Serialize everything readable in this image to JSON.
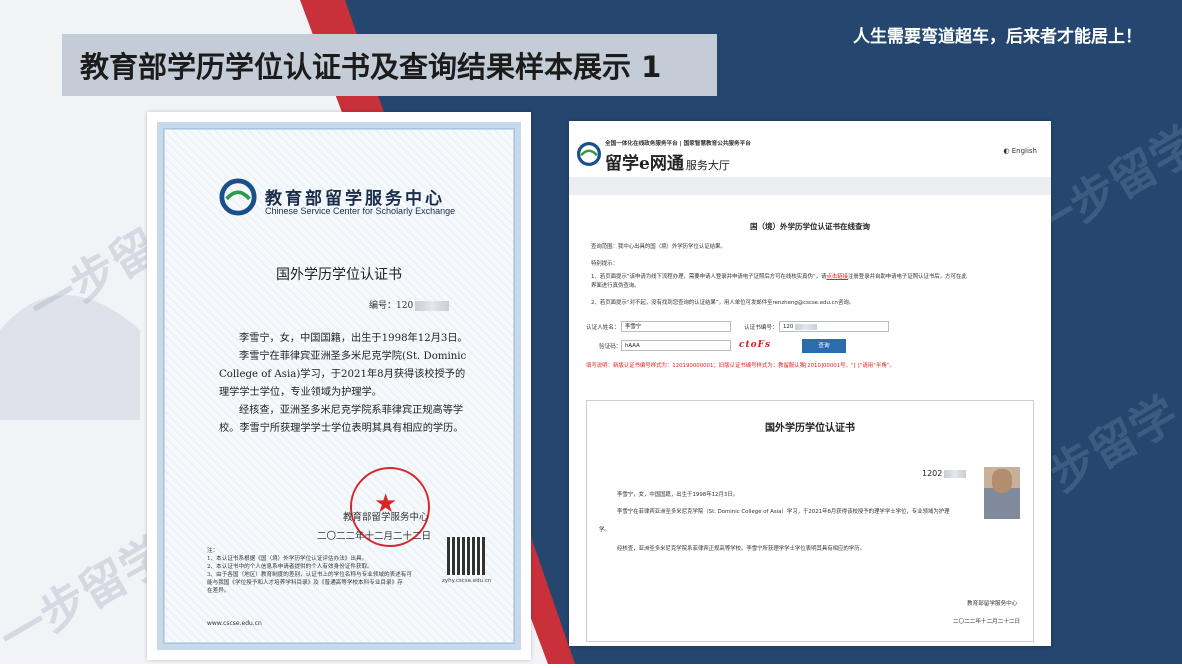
{
  "slide": {
    "title": "教育部学历学位认证书及查询结果样本展示 1",
    "slogan": "人生需要弯道超车，后来者才能居上！",
    "watermark": "一步留学"
  },
  "certificate": {
    "org_cn": "教育部留学服务中心",
    "org_en": "Chinese Service Center for Scholarly Exchange",
    "title": "国外学历学位认证书",
    "number": "编号：120",
    "paragraphs": [
      "李雪宁，女，中国国籍，出生于1998年12月3日。",
      "李雪宁在菲律宾亚洲圣多米尼克学院(St. Dominic College of Asia)学习，于2021年8月获得该校授予的理学学士学位，专业领域为护理学。",
      "经核查，亚洲圣多米尼克学院系菲律宾正规高等学校。李雪宁所获理学学士学位表明其具有相应的学历。"
    ],
    "sign": "教育部留学服务中心",
    "date": "二〇二二年十二月二十二日",
    "qr_caption": "zyhy.cscse.edu.cn",
    "notes": [
      "注：",
      "1、本认证书系根据《国（境）外学历学位认证评估办法》出具。",
      "2、本认证书中的个人信息系申请者提供的个人有效身份证件获取。",
      "3、由于各国（地区）教育制度的差别，认证书上的学位名称与专业领域的表述有可",
      "能与我国《学位授予和人才培养学科目录》及《普通高等学校本科专业目录》存",
      "在差异。"
    ],
    "url": "www.cscse.edu.cn"
  },
  "web": {
    "platform": "全国一体化在线政务服务平台 | 国家智慧教育公共服务平台",
    "brand": "留学e网通",
    "brand_suffix": "服务大厅",
    "lang": "English",
    "query_title": "国（境）外学历学位认证书在线查询",
    "scope": "查询范围：我中心出具的国（境）外学历学位认证结果。",
    "tip_head": "特别提示：",
    "tip1_a": "1、若页面提示“该申请为线下流程办理，需要申请人登录并申请电子证照后方可在线核实真伪”，请",
    "tip1_link": "点击链接",
    "tip1_b": "注册登录并自助申请电子证照认证书后，方可在此",
    "tip1_c": "界面进行真伪查询。",
    "tip2": "2、若页面提示“对不起，没有找到您查询的认证结果”，用人单位可发邮件至renzheng@cscse.edu.cn咨询。",
    "name_label": "认证人姓名：",
    "name_value": "李雪宁",
    "no_label": "认证书编号：",
    "no_value": "120",
    "code_label": "验证码：",
    "code_value": "hAAA",
    "captcha": "ctoFs",
    "query_button": "查询",
    "warn": "填写说明：新版认证书编号样式为：120190000001；旧版认证书编号样式为：教留服认案[2010]00001号。“[ ]”请用“半角”。",
    "result": {
      "title": "国外学历学位认证书",
      "number": "1202",
      "p1": "李雪宁，女，中国国籍，出生于1998年12月3日。",
      "p2": "李雪宁在菲律宾亚洲圣多米尼克学院（St. Dominic College of Asia）学习，于2021年8月获得该校授予的理学学士学位，专业领域为护理",
      "p2b": "学。",
      "p3": "经核查，亚洲圣多米尼克学院系菲律宾正规高等学校。李雪宁所获理学学士学位表明其具有相应的学历。",
      "sign": "教育部留学服务中心",
      "date": "二〇二二年十二月二十二日"
    }
  }
}
